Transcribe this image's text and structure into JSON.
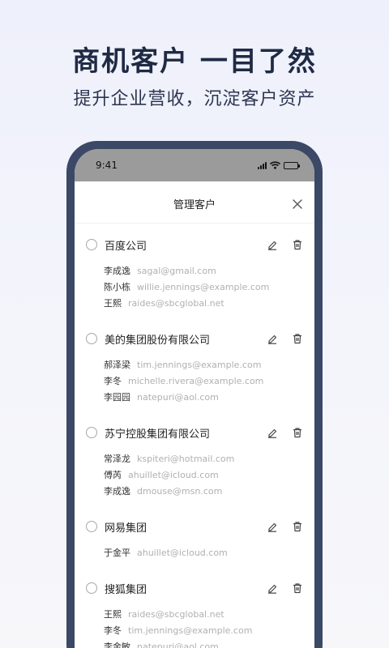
{
  "promo": {
    "headline": "商机客户 一目了然",
    "subline": "提升企业营收，沉淀客户资产"
  },
  "status_bar": {
    "time": "9:41"
  },
  "sheet": {
    "title": "管理客户",
    "companies": [
      {
        "name": "百度公司",
        "contacts": [
          {
            "name": "李成逸",
            "email": "sagal@gmail.com"
          },
          {
            "name": "陈小栋",
            "email": "willie.jennings@example.com"
          },
          {
            "name": "王熙",
            "email": "raides@sbcglobal.net"
          }
        ]
      },
      {
        "name": "美的集团股份有限公司",
        "contacts": [
          {
            "name": "郝泽梁",
            "email": "tim.jennings@example.com"
          },
          {
            "name": "李冬",
            "email": "michelle.rivera@example.com"
          },
          {
            "name": "李园园",
            "email": "natepuri@aol.com"
          }
        ]
      },
      {
        "name": "苏宁控股集团有限公司",
        "contacts": [
          {
            "name": "常泽龙",
            "email": "kspiteri@hotmail.com"
          },
          {
            "name": "傅芮",
            "email": "ahuillet@icloud.com"
          },
          {
            "name": "李成逸",
            "email": "dmouse@msn.com"
          }
        ]
      },
      {
        "name": "网易集团",
        "contacts": [
          {
            "name": "于金平",
            "email": "ahuillet@icloud.com"
          }
        ]
      },
      {
        "name": "搜狐集团",
        "contacts": [
          {
            "name": "王熙",
            "email": "raides@sbcglobal.net"
          },
          {
            "name": "李冬",
            "email": "tim.jennings@example.com"
          },
          {
            "name": "李金敏",
            "email": "natepuri@aol.com"
          }
        ]
      }
    ]
  },
  "icons": {
    "close": "close-icon",
    "edit": "edit-icon",
    "delete": "trash-icon"
  },
  "colors": {
    "phone_frame": "#3b4866",
    "headline": "#1f2a44",
    "email_text": "#b0b0b0"
  }
}
